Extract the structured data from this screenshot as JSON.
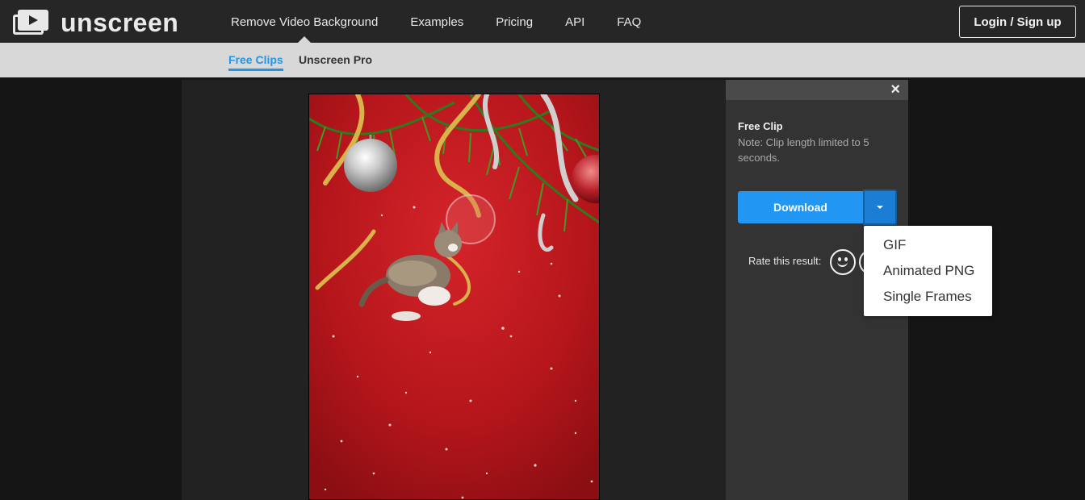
{
  "brand": {
    "name": "unscreen"
  },
  "nav": {
    "items": [
      {
        "label": "Remove Video Background",
        "active": true
      },
      {
        "label": "Examples"
      },
      {
        "label": "Pricing"
      },
      {
        "label": "API"
      },
      {
        "label": "FAQ"
      }
    ],
    "login_label": "Login / Sign up"
  },
  "subnav": {
    "tabs": [
      {
        "label": "Free Clips",
        "active": true
      },
      {
        "label": "Unscreen Pro"
      }
    ]
  },
  "panel": {
    "close_symbol": "×",
    "title": "Free Clip",
    "note": "Note: Clip length limited to 5 seconds.",
    "download_label": "Download",
    "rate_label": "Rate this result:"
  },
  "download_menu": {
    "options": [
      "GIF",
      "Animated PNG",
      "Single Frames"
    ]
  },
  "colors": {
    "accent": "#2196f3",
    "accent_dark": "#1c7dd4",
    "topbar": "#262626",
    "subbar": "#d8d8d8",
    "video_background": "#b5161b"
  }
}
